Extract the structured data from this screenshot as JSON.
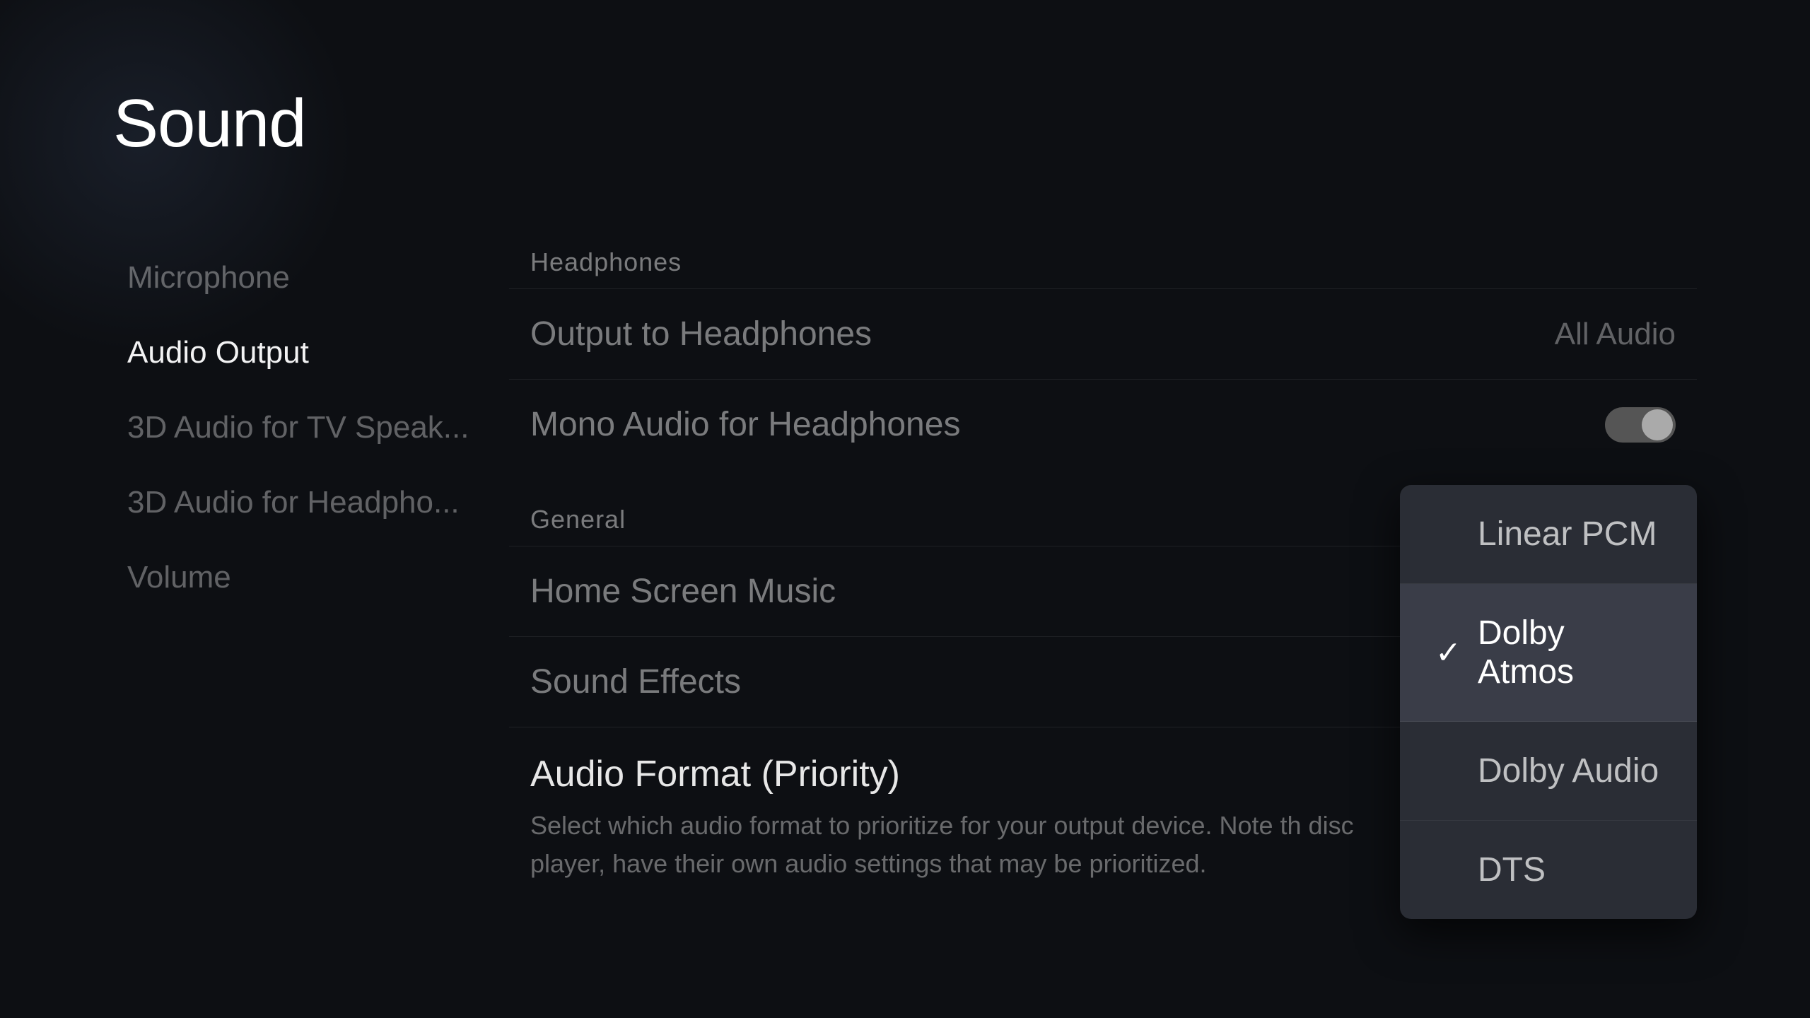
{
  "page": {
    "title": "Sound"
  },
  "sidebar": {
    "items": [
      {
        "id": "microphone",
        "label": "Microphone",
        "active": false
      },
      {
        "id": "audio-output",
        "label": "Audio Output",
        "active": true
      },
      {
        "id": "3d-tv",
        "label": "3D Audio for TV Speak...",
        "active": false
      },
      {
        "id": "3d-headphone",
        "label": "3D Audio for Headpho...",
        "active": false
      },
      {
        "id": "volume",
        "label": "Volume",
        "active": false
      }
    ]
  },
  "headphones_section": {
    "header": "Headphones",
    "output_to_headphones": {
      "label": "Output to Headphones",
      "value": "All Audio"
    },
    "mono_audio": {
      "label": "Mono Audio for Headphones",
      "toggle_state": "off"
    }
  },
  "general_section": {
    "header": "General",
    "home_screen_music": {
      "label": "Home Screen Music",
      "toggle_state": "off"
    },
    "sound_effects": {
      "label": "Sound Effects"
    }
  },
  "audio_format": {
    "title": "Audio Format (Priority)",
    "description": "Select which audio format to prioritize for your output device. Note th disc player, have their own audio settings that may be prioritized."
  },
  "dropdown": {
    "items": [
      {
        "id": "linear-pcm",
        "label": "Linear PCM",
        "selected": false
      },
      {
        "id": "dolby-atmos",
        "label": "Dolby Atmos",
        "selected": true
      },
      {
        "id": "dolby-audio",
        "label": "Dolby Audio",
        "selected": false
      },
      {
        "id": "dts",
        "label": "DTS",
        "selected": false
      }
    ]
  }
}
